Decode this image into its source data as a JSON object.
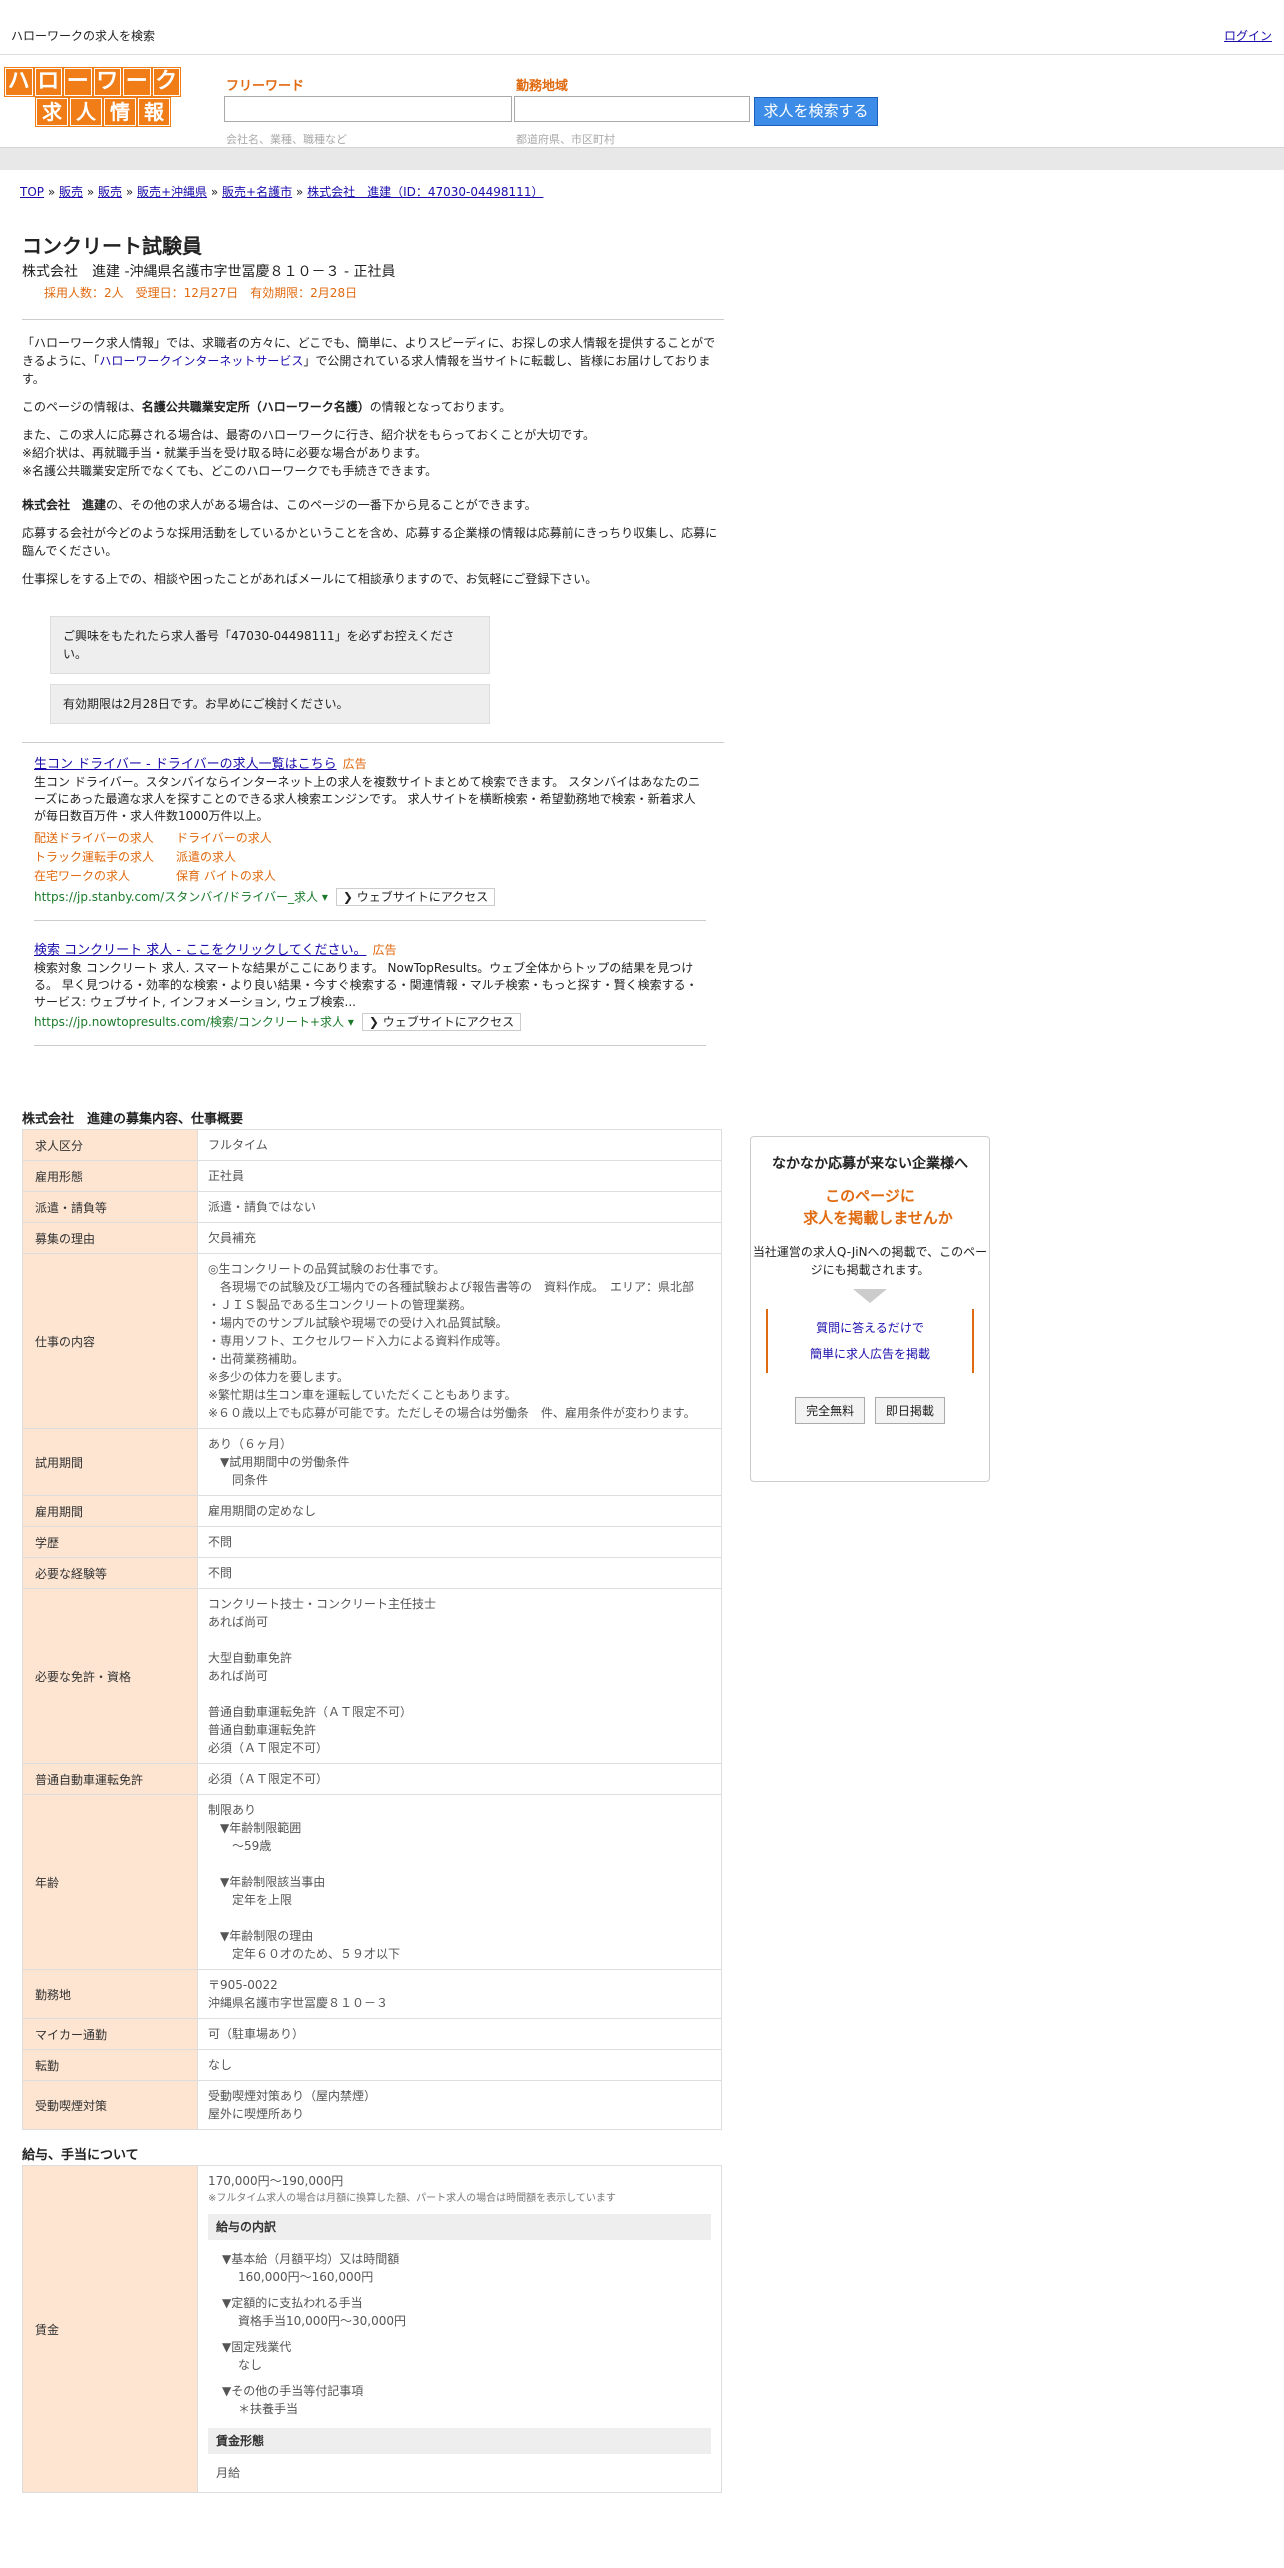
{
  "topbar": {
    "site_title": "ハローワークの求人を検索",
    "login": "ログイン"
  },
  "logo": {
    "row1": [
      "ハ",
      "ロ",
      "ー",
      "ワ",
      "ー",
      "ク"
    ],
    "row2": [
      "求",
      "人",
      "情",
      "報"
    ]
  },
  "search": {
    "freeword_label": "フリーワード",
    "area_label": "勤務地域",
    "freeword_hint": "会社名、業種、職種など",
    "area_hint": "都道府県、市区町村",
    "button": "求人を検索する"
  },
  "breadcrumb": [
    "TOP",
    "販売",
    "販売",
    "販売+沖縄県",
    "販売+名護市",
    "株式会社　進建（ID：47030-04498111）"
  ],
  "job": {
    "title": "コンクリート試験員",
    "company_line": "株式会社　進建 -沖縄県名護市字世冨慶８１０－３ - 正社員",
    "meta": "採用人数：2人　受理日：12月27日　有効期限：2月28日"
  },
  "intro": {
    "p1_a": "「ハローワーク求人情報」では、求職者の方々に、どこでも、簡単に、よりスピーディに、お探しの求人情報を提供することができるように、「",
    "p1_link": "ハローワークインターネットサービス",
    "p1_b": "」で公開されている求人情報を当サイトに転載し、皆様にお届けしております。",
    "p2_a": "このページの情報は、",
    "p2_bold": "名護公共職業安定所（ハローワーク名護）",
    "p2_b": "の情報となっております。",
    "p3": "また、この求人に応募される場合は、最寄のハローワークに行き、紹介状をもらっておくことが大切です。",
    "p4": "※紹介状は、再就職手当・就業手当を受け取る時に必要な場合があります。",
    "p5": "※名護公共職業安定所でなくても、どこのハローワークでも手続きできます。",
    "p6_bold": "株式会社　進建",
    "p6": "の、その他の求人がある場合は、このページの一番下から見ることができます。",
    "p7": "応募する会社が今どのような採用活動をしているかということを含め、応募する企業様の情報は応募前にきっちり収集し、応募に臨んでください。",
    "p8": "仕事探しをする上での、相談や困ったことがあればメールにて相談承りますので、お気軽にご登録下さい。"
  },
  "notes": [
    "ご興味をもたれたら求人番号「47030-04498111」を必ずお控えください。",
    "有効期限は2月28日です。お早めにご検討ください。"
  ],
  "ads": [
    {
      "title": "生コン ドライバー - ドライバーの求人一覧はこちら",
      "badge": "広告",
      "desc": "生コン ドライバー。スタンバイならインターネット上の求人を複数サイトまとめて検索できます。 スタンバイはあなたのニーズにあった最適な求人を探すことのできる求人検索エンジンです。 求人サイトを横断検索・希望勤務地で検索・新着求人が毎日数百万件・求人件数1000万件以上。",
      "links": [
        "配送ドライバーの求人",
        "ドライバーの求人",
        "トラック運転手の求人",
        "派遣の求人",
        "在宅ワークの求人",
        "保育 バイトの求人"
      ],
      "url": "https://jp.stanby.com/スタンバイ/ドライバー_求人",
      "visit": "❯ ウェブサイトにアクセス"
    },
    {
      "title": "検索 コンクリート 求人 - ここをクリックしてください。",
      "badge": "広告",
      "desc": "検索対象 コンクリート 求人. スマートな結果がここにあります。 NowTopResults。ウェブ全体からトップの結果を見つける。 早く見つける・効率的な検索・より良い結果・今すぐ検索する・関連情報・マルチ検索・もっと探す・賢く検索する・サービス: ウェブサイト, インフォメーション, ウェブ検索...",
      "links": [],
      "url": "https://jp.nowtopresults.com/検索/コンクリート+求人",
      "visit": "❯ ウェブサイトにアクセス"
    }
  ],
  "section1_title": "株式会社　進建の募集内容、仕事概要",
  "table1": [
    {
      "k": "求人区分",
      "v": "フルタイム"
    },
    {
      "k": "雇用形態",
      "v": "正社員"
    },
    {
      "k": "派遣・請負等",
      "v": "派遣・請負ではない"
    },
    {
      "k": "募集の理由",
      "v": "欠員補充"
    },
    {
      "k": "仕事の内容",
      "v": "◎生コンクリートの品質試験のお仕事です。\n　各現場での試験及び工場内での各種試験および報告書等の　資料作成。　エリア：県北部\n・ＪＩＳ製品である生コンクリートの管理業務。\n・場内でのサンプル試験や現場での受け入れ品質試験。\n・専用ソフト、エクセルワード入力による資料作成等。\n・出荷業務補助。\n※多少の体力を要します。\n※繁忙期は生コン車を運転していただくこともあります。\n※６０歳以上でも応募が可能です。ただしその場合は労働条　件、雇用条件が変わります。"
    },
    {
      "k": "試用期間",
      "v": "あり（６ヶ月）\n　▼試用期間中の労働条件\n　　同条件"
    },
    {
      "k": "雇用期間",
      "v": "雇用期間の定めなし"
    },
    {
      "k": "学歴",
      "v": "不問"
    },
    {
      "k": "必要な経験等",
      "v": "不問"
    },
    {
      "k": "必要な免許・資格",
      "v": "コンクリート技士・コンクリート主任技士\nあれば尚可\n\n大型自動車免許\nあれば尚可\n\n普通自動車運転免許（ＡＴ限定不可）\n普通自動車運転免許\n必須（ＡＴ限定不可）\n"
    },
    {
      "k": "普通自動車運転免許",
      "v": "必須（ＡＴ限定不可）"
    },
    {
      "k": "年齢",
      "v": "制限あり\n　▼年齢制限範囲\n　　〜59歳\n\n　▼年齢制限該当事由\n　　定年を上限\n\n　▼年齢制限の理由\n　　定年６０才のため、５９才以下"
    },
    {
      "k": "勤務地",
      "v": "〒905-0022\n沖縄県名護市字世冨慶８１０－３"
    },
    {
      "k": "マイカー通勤",
      "v": "可（駐車場あり）"
    },
    {
      "k": "転勤",
      "v": "なし"
    },
    {
      "k": "受動喫煙対策",
      "v": "受動喫煙対策あり（屋内禁煙）\n屋外に喫煙所あり"
    }
  ],
  "section2_title": "給与、手当について",
  "wage": {
    "label": "賃金",
    "range": "170,000円〜190,000円",
    "note": "※フルタイム求人の場合は月額に換算した額、パート求人の場合は時間額を表示しています",
    "breakdown_title": "給与の内訳",
    "items": [
      {
        "h": "▼基本給（月額平均）又は時間額",
        "v": "160,000円〜160,000円"
      },
      {
        "h": "▼定額的に支払われる手当",
        "v": "資格手当10,000円〜30,000円"
      },
      {
        "h": "▼固定残業代",
        "v": "なし"
      },
      {
        "h": "▼その他の手当等付記事項",
        "v": "＊扶養手当"
      }
    ],
    "form_title": "賃金形態",
    "form": "月給"
  },
  "side": {
    "heading": "なかなか応募が来ない企業様へ",
    "orange1": "このページに",
    "orange2": "求人を掲載しませんか",
    "text": "当社運営の求人Q-JiNへの掲載で、このページにも掲載されます。",
    "link1": "質問に答えるだけで",
    "link2": "簡単に求人広告を掲載",
    "btn1": "完全無料",
    "btn2": "即日掲載"
  }
}
